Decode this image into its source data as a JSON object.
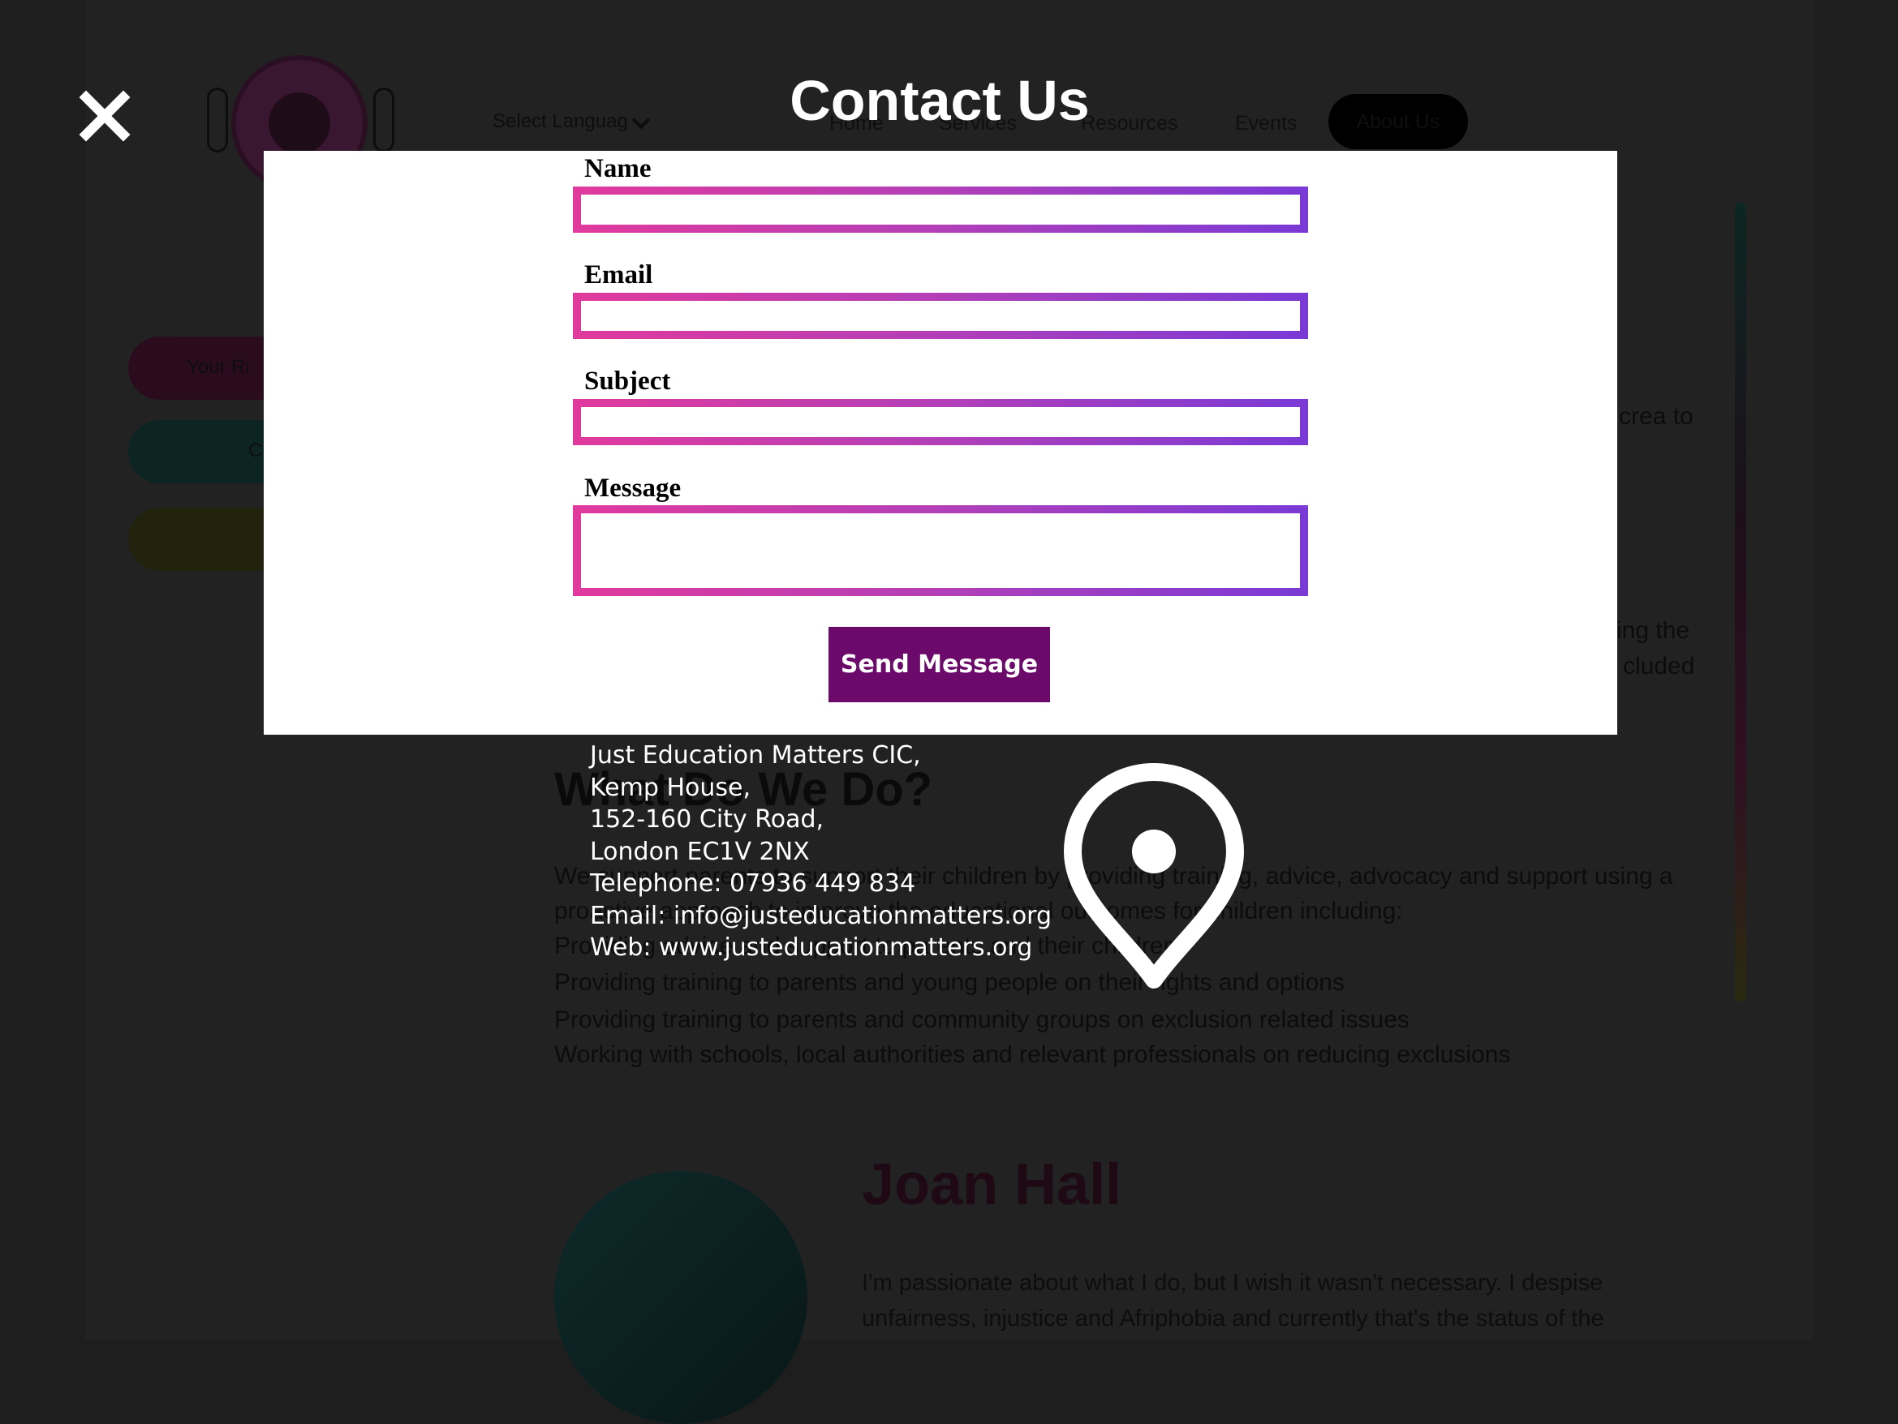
{
  "background": {
    "language_select": "Select Languag",
    "nav": [
      "Home",
      "Services",
      "Resources",
      "Events",
      "About Us"
    ],
    "side_pills": [
      "Your Ri",
      "C",
      ""
    ],
    "text_fragments": {
      "right_1": "crea to",
      "right_2": "ing the",
      "right_3": "cluded"
    },
    "heading": "What Do We Do?",
    "intro": "We support parents to support their children by providing training, advice, advocacy and support using a",
    "intro2": "proactive approach to improve the educational outcomes for children including:",
    "bullets": [
      "Providing advice and support to parents and their children",
      "Providing training to parents and young people on their rights and options",
      "Providing training to parents and community groups on exclusion related issues",
      "Working with schools, local authorities and relevant professionals on reducing exclusions"
    ],
    "profile_name": "Joan Hall",
    "profile_para_1": "I'm passionate about what I do, but I wish it wasn't necessary. I despise",
    "profile_para_2": "unfairness, injustice and Afriphobia and currently that's the status of the"
  },
  "modal": {
    "title": "Contact Us",
    "close_icon": "close-icon",
    "fields": {
      "name_label": "Name",
      "name_value": "",
      "email_label": "Email",
      "email_value": "",
      "subject_label": "Subject",
      "subject_value": "",
      "message_label": "Message",
      "message_value": ""
    },
    "send_label": "Send Message"
  },
  "contact": {
    "lines": [
      "Just Education Matters CIC,",
      "Kemp House,",
      "152-160 City Road,",
      "London EC1V 2NX",
      "Telephone: 07936 449 834",
      "Email: info@justeducationmatters.org",
      "Web: www.justeducationmatters.org"
    ],
    "pin_icon": "map-pin-icon"
  },
  "colors": {
    "gradient_start": "#e13a9d",
    "gradient_end": "#7a3ad6",
    "button": "#6b0a6b",
    "overlay": "#1e1e1e"
  }
}
